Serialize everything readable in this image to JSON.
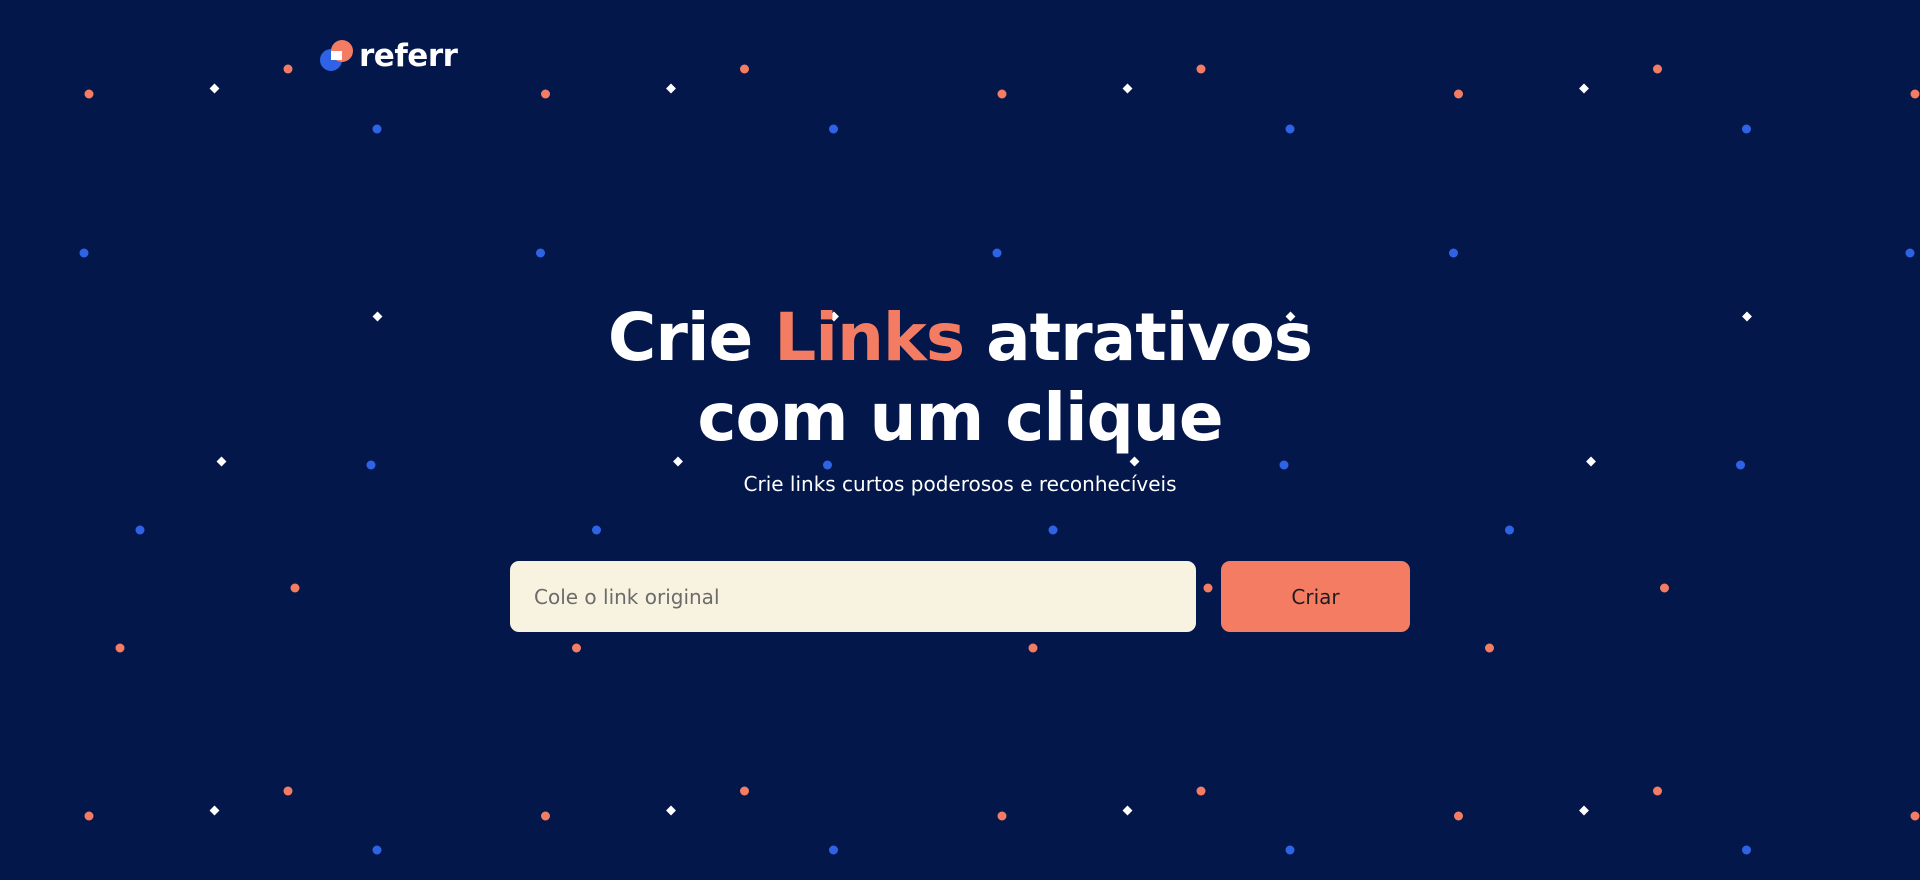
{
  "brand": {
    "name": "referr",
    "colors": {
      "background": "#04174A",
      "accent": "#F47C63",
      "blue": "#2F63E6",
      "input_background": "#F8F3E0"
    }
  },
  "hero": {
    "headline_part1": "Crie ",
    "headline_accent": "Links",
    "headline_part2": " atrativos",
    "headline_line2": "com um clique",
    "subtitle": "Crie links curtos poderosos e reconhecíveis"
  },
  "form": {
    "input_placeholder": "Cole o link original",
    "input_value": "",
    "submit_label": "Criar"
  },
  "icons": {
    "logo": "referr-logo-icon"
  }
}
